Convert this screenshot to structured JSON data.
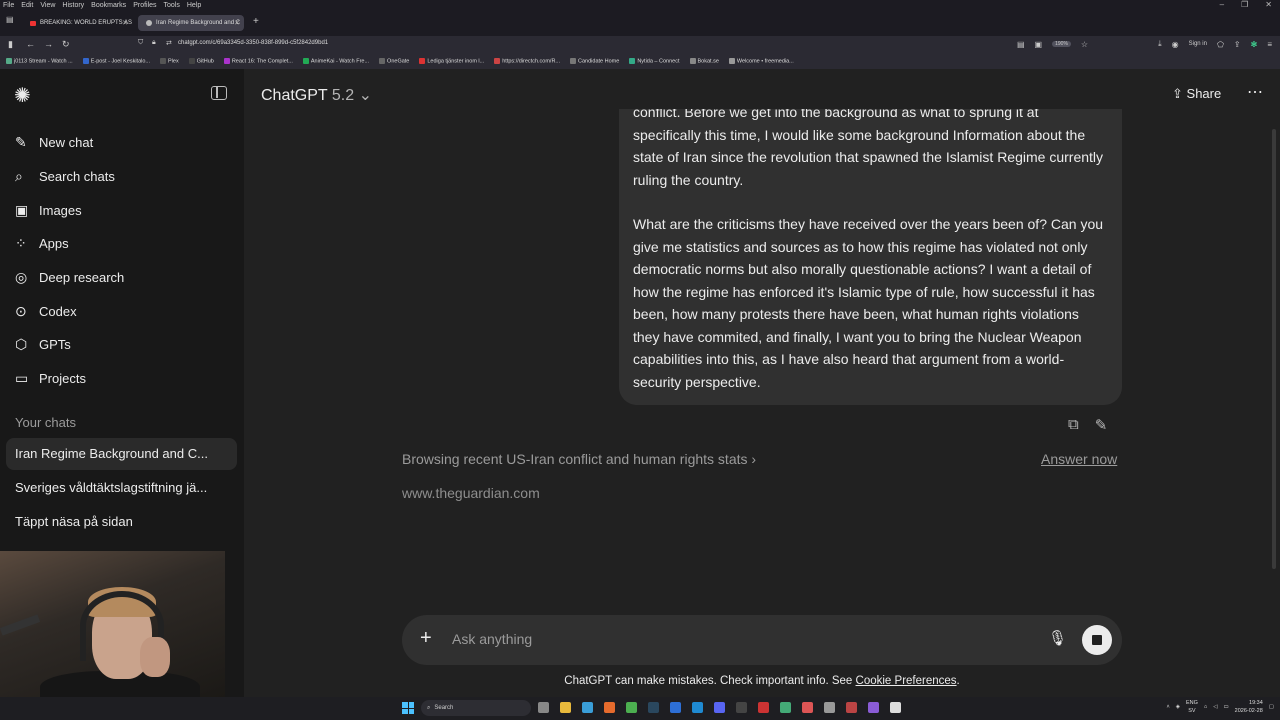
{
  "browser": {
    "menu": [
      "File",
      "Edit",
      "View",
      "History",
      "Bookmarks",
      "Profiles",
      "Tools",
      "Help"
    ],
    "tabs": [
      {
        "title": "BREAKING: WORLD ERUPTS AS"
      },
      {
        "title": "Iran Regime Background and C"
      }
    ],
    "url": "chatgpt.com/c/69a3345d-3350-838f-899d-c5f2842d9bd1",
    "zoom": "190%",
    "sign_in": "Sign in",
    "bookmarks": [
      "j0113 Stream - Watch ...",
      "E-post - Joel Keskitalo...",
      "Plex",
      "GitHub",
      "React 16: The Complet...",
      "AnimeKai - Watch Fre...",
      "OneGate",
      "Lediga tjänster inom l...",
      "https://directch.com/R...",
      "Candidate Home",
      "Nytida – Connect",
      "Bokat.se",
      "Welcome • freemedia..."
    ]
  },
  "sidebar": {
    "nav": [
      {
        "label": "New chat",
        "icon": "✎"
      },
      {
        "label": "Search chats",
        "icon": "⌕"
      },
      {
        "label": "Images",
        "icon": "▣"
      },
      {
        "label": "Apps",
        "icon": "⁘"
      },
      {
        "label": "Deep research",
        "icon": "◎"
      },
      {
        "label": "Codex",
        "icon": "⊙"
      },
      {
        "label": "GPTs",
        "icon": "⬡"
      },
      {
        "label": "Projects",
        "icon": "▭"
      }
    ],
    "section_label": "Your chats",
    "chats": [
      "Iran Regime Background and C...",
      "Sveriges våldtäktslagstiftning jä...",
      "Täppt näsa på sidan"
    ]
  },
  "header": {
    "model_name": "ChatGPT",
    "model_version": "5.2",
    "share_label": "Share"
  },
  "conversation": {
    "user_message_p1": "conflict. Before we get into the background as what to sprung it at specifically this time, I would like some background Information about the state of Iran since the revolution that spawned the Islamist Regime currently ruling the country.",
    "user_message_p2": "What are the criticisms they have received over the years been of? Can you give me statistics and sources as to how this regime has violated not only democratic norms but also morally questionable actions? I want a detail of how the regime has enforced it's Islamic type of rule, how successful it has been, how many protests there have been, what human rights violations they have commited, and finally, I want you to bring the Nuclear Weapon capabilities into this, as I have also heard that argument from a world-security perspective.",
    "status": "Browsing recent US-Iran conflict and human rights stats",
    "answer_now": "Answer now",
    "source": "www.theguardian.com"
  },
  "composer": {
    "placeholder": "Ask anything"
  },
  "disclaimer": {
    "text": "ChatGPT can make mistakes. Check important info. See",
    "link": "Cookie Preferences",
    "end": "."
  },
  "taskbar": {
    "search": "Search",
    "lang_1": "ENG",
    "lang_2": "SV",
    "time": "19:34",
    "date": "2026-02-28"
  }
}
